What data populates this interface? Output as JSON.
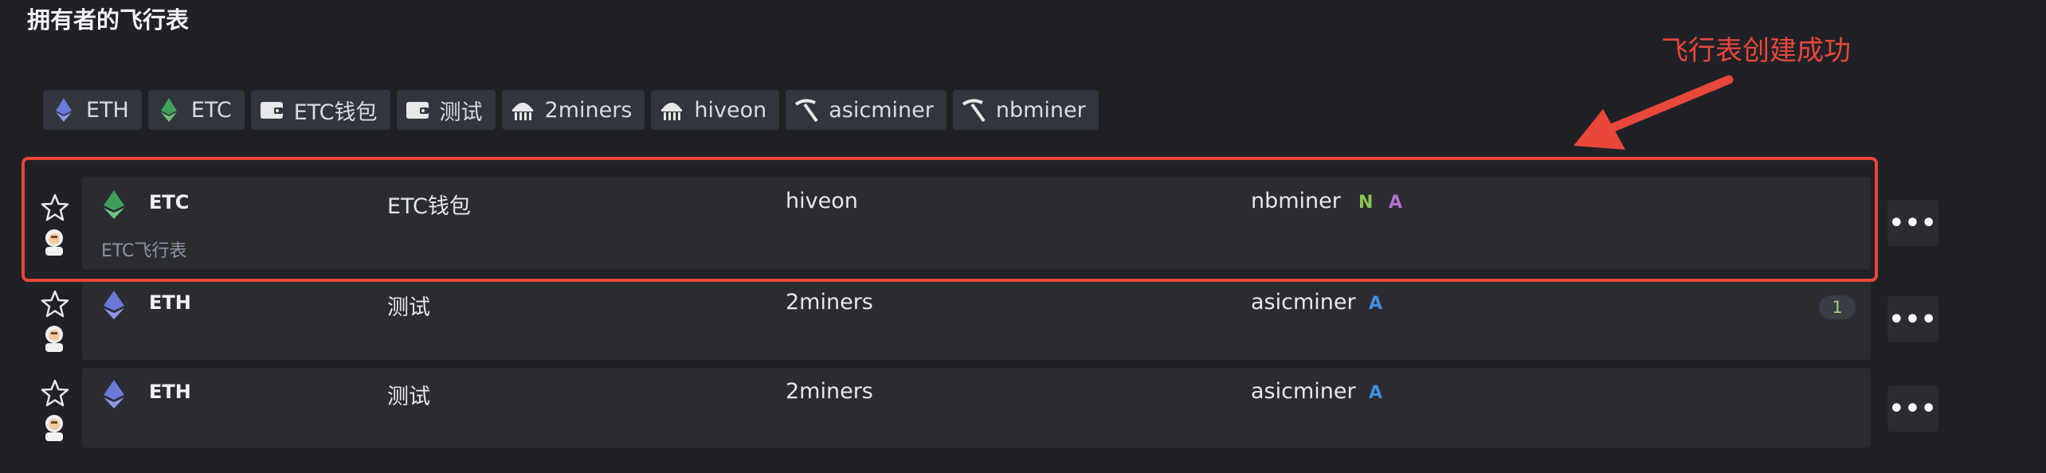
{
  "header": {
    "title": "拥有者的飞行表"
  },
  "annotation": {
    "text": "飞行表创建成功"
  },
  "tags": [
    {
      "label": "ETH",
      "icon": "eth-icon"
    },
    {
      "label": "ETC",
      "icon": "etc-icon"
    },
    {
      "label": "ETC钱包",
      "icon": "wallet-icon"
    },
    {
      "label": "测试",
      "icon": "wallet-icon"
    },
    {
      "label": "2miners",
      "icon": "pool-icon"
    },
    {
      "label": "hiveon",
      "icon": "pool-icon"
    },
    {
      "label": "asicminer",
      "icon": "pickaxe-icon"
    },
    {
      "label": "nbminer",
      "icon": "pickaxe-icon"
    }
  ],
  "rows": [
    {
      "coin": "ETC",
      "wallet": "ETC钱包",
      "pool": "hiveon",
      "miner": "nbminer",
      "flags": [
        "N",
        "A"
      ],
      "name": "ETC飞行表"
    },
    {
      "coin": "ETH",
      "wallet": "测试",
      "pool": "2miners",
      "miner": "asicminer",
      "flags": [
        "A"
      ],
      "badge": "1"
    },
    {
      "coin": "ETH",
      "wallet": "测试",
      "pool": "2miners",
      "miner": "asicminer",
      "flags": [
        "A"
      ]
    }
  ],
  "more_label": "•••",
  "colors": {
    "highlight": "#e8473a",
    "flag_n": "#8fc552",
    "flag_a_purple": "#b070d0",
    "flag_a_blue": "#3f8fe0"
  }
}
